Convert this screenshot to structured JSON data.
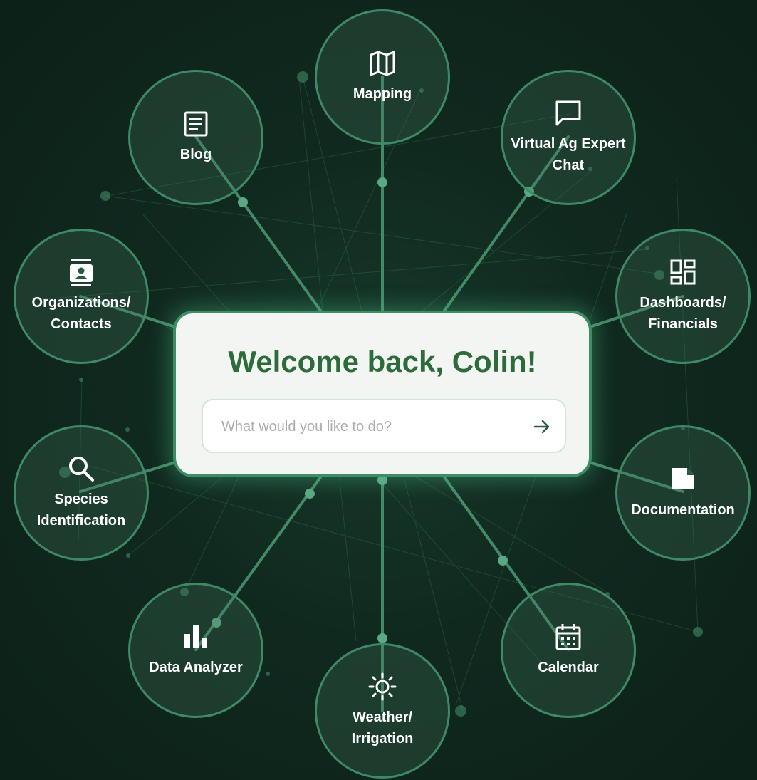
{
  "welcome": "Welcome back, Colin!",
  "search": {
    "placeholder": "What would you like to do?",
    "submit_icon": "arrow-right-icon"
  },
  "nodes": [
    {
      "label": "Mapping",
      "icon": "map-icon"
    },
    {
      "label": "Virtual Ag Expert\nChat",
      "icon": "chat-icon"
    },
    {
      "label": "Dashboards/\nFinancials",
      "icon": "dashboard-icon"
    },
    {
      "label": "Documentation",
      "icon": "document-icon"
    },
    {
      "label": "Calendar",
      "icon": "calendar-icon"
    },
    {
      "label": "Weather/\nIrrigation",
      "icon": "sun-icon"
    },
    {
      "label": "Data Analyzer",
      "icon": "bar-chart-icon"
    },
    {
      "label": "Species\nIdentification",
      "icon": "search-icon"
    },
    {
      "label": "Organizations/\nContacts",
      "icon": "contacts-icon"
    },
    {
      "label": "Blog",
      "icon": "article-icon"
    }
  ],
  "colors": {
    "background": "#10291f",
    "accent": "#3f8a66",
    "title": "#2e6b3a",
    "card": "#f3f5f3"
  }
}
